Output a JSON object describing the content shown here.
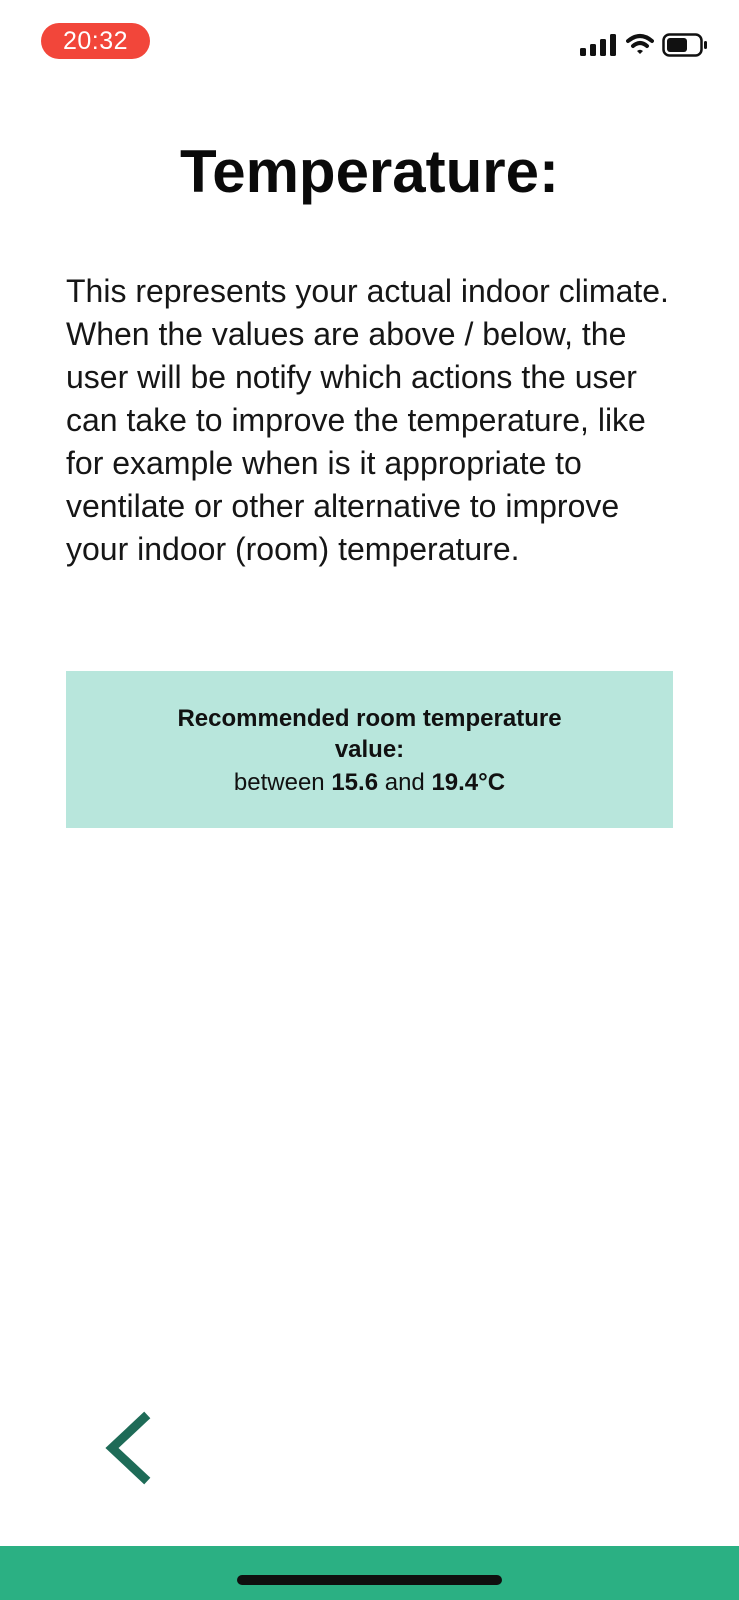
{
  "status_bar": {
    "time": "20:32",
    "time_pill_color": "#f2463a",
    "icons": [
      "signal-icon",
      "wifi-icon",
      "battery-icon"
    ]
  },
  "page": {
    "title": "Temperature:",
    "description": "This represents your actual indoor climate. When the values are above / below, the user will be notify which actions the user can take to improve the temperature, like for example when is it appropriate to ventilate or other alternative to improve your indoor (room) temperature."
  },
  "recommendation": {
    "heading": "Recommended room temperature value:",
    "prefix": "between",
    "low": "15.6",
    "connector": "and",
    "high": "19.4°C",
    "background_color": "#b8e6dc"
  },
  "navigation": {
    "back_icon": "chevron-left-icon",
    "accent_color": "#1e6b57"
  },
  "footer": {
    "bar_color": "#2bb083"
  }
}
